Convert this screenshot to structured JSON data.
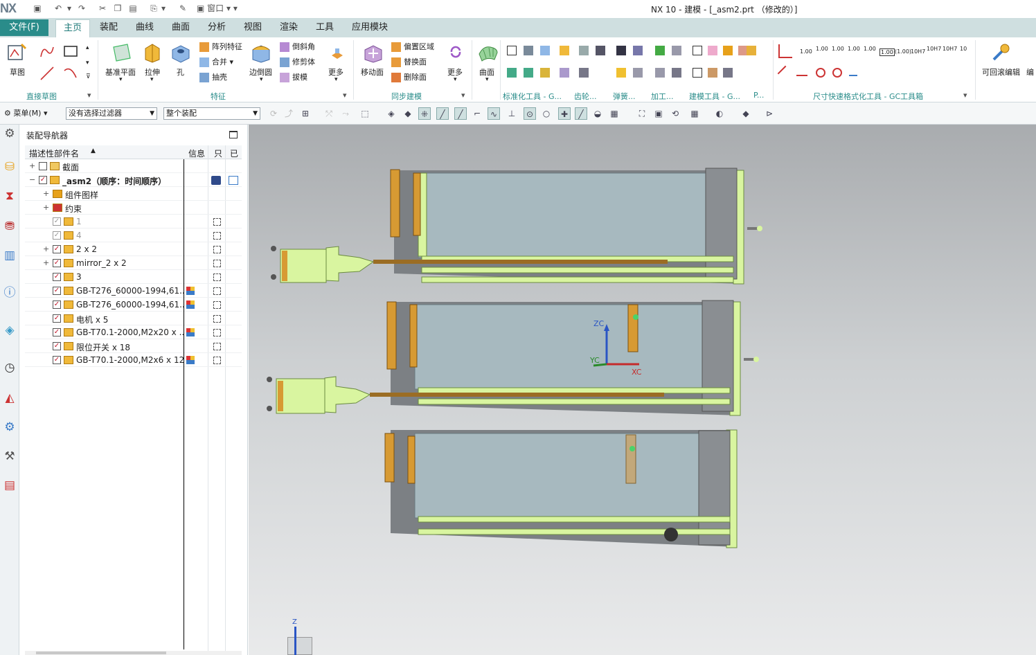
{
  "app": {
    "logo": "NX",
    "window_title": "NX 10 - 建模 - [_asm2.prt （修改的）]"
  },
  "quick_access": {
    "window_menu_label": "窗口"
  },
  "file_tab": "文件(F)",
  "tabs": [
    "主页",
    "装配",
    "曲线",
    "曲面",
    "分析",
    "视图",
    "渲染",
    "工具",
    "应用模块"
  ],
  "ribbon": {
    "sketch": "草图",
    "datum_plane": "基准平面",
    "extrude": "拉伸",
    "hole": "孔",
    "pattern_feature": "阵列特征",
    "unite": "合并",
    "shell": "抽壳",
    "edge_blend": "边倒圆",
    "chamfer": "倒斜角",
    "trim_body": "修剪体",
    "draft": "拔模",
    "more1": "更多",
    "move_face": "移动面",
    "offset_region": "偏置区域",
    "replace_face": "替换面",
    "delete_face": "删除面",
    "more2": "更多",
    "surface": "曲面",
    "rollback_edit": "可回滚编辑",
    "edit_cut": "编",
    "tol_labels": [
      "1.00",
      "1.00",
      "1.00",
      "1.00",
      "1.00",
      "1.00",
      "(1.00)",
      "10H7",
      "10H7",
      "10H7",
      "10"
    ],
    "groups": {
      "direct_sketch": "直接草图",
      "feature": "特征",
      "sync_modeling": "同步建模",
      "std_tools": "标准化工具 - G...",
      "gear": "齿轮...",
      "spring": "弹簧...",
      "machining": "加工...",
      "modeling_tools": "建模工具 - G...",
      "p": "P...",
      "dim_tools": "尺寸快速格式化工具 - GC工具箱"
    }
  },
  "toolbar2": {
    "menu": "菜单(M)",
    "filter": "没有选择过滤器",
    "scope": "整个装配"
  },
  "navigator": {
    "title": "装配导航器",
    "col_name": "描述性部件名",
    "col_info": "信息",
    "col_only": "只",
    "col_mod": "已",
    "rows": [
      {
        "label": "截面",
        "indent": 0,
        "expander": "+",
        "checked": false,
        "gray": false,
        "bold": false,
        "info": false,
        "only": false,
        "type": "folder"
      },
      {
        "label": "_asm2（顺序：时间顺序）",
        "indent": 0,
        "expander": "−",
        "checked": true,
        "gray": false,
        "bold": true,
        "info": false,
        "only": false,
        "type": "asm"
      },
      {
        "label": "组件图样",
        "indent": 1,
        "expander": "+",
        "checked": null,
        "gray": false,
        "bold": false,
        "info": false,
        "only": false,
        "type": "pattern"
      },
      {
        "label": "约束",
        "indent": 1,
        "expander": "+",
        "checked": null,
        "gray": false,
        "bold": false,
        "info": false,
        "only": false,
        "type": "constraint"
      },
      {
        "label": "1",
        "indent": 1,
        "expander": "",
        "checked": true,
        "gray": true,
        "bold": false,
        "info": false,
        "only": true,
        "type": "part"
      },
      {
        "label": "4",
        "indent": 1,
        "expander": "",
        "checked": true,
        "gray": true,
        "bold": false,
        "info": false,
        "only": true,
        "type": "part"
      },
      {
        "label": "2 x 2",
        "indent": 1,
        "expander": "+",
        "checked": true,
        "gray": false,
        "bold": false,
        "info": false,
        "only": true,
        "type": "asm"
      },
      {
        "label": "mirror_2 x 2",
        "indent": 1,
        "expander": "+",
        "checked": true,
        "gray": false,
        "bold": false,
        "info": false,
        "only": true,
        "type": "asm"
      },
      {
        "label": "3",
        "indent": 1,
        "expander": "",
        "checked": true,
        "gray": false,
        "bold": false,
        "info": false,
        "only": true,
        "type": "part"
      },
      {
        "label": "GB-T276_60000-1994,61...",
        "indent": 1,
        "expander": "",
        "checked": true,
        "gray": false,
        "bold": false,
        "info": true,
        "only": true,
        "type": "part"
      },
      {
        "label": "GB-T276_60000-1994,61...",
        "indent": 1,
        "expander": "",
        "checked": true,
        "gray": false,
        "bold": false,
        "info": true,
        "only": true,
        "type": "part"
      },
      {
        "label": "电机 x 5",
        "indent": 1,
        "expander": "",
        "checked": true,
        "gray": false,
        "bold": false,
        "info": false,
        "only": true,
        "type": "part"
      },
      {
        "label": "GB-T70.1-2000,M2x20 x ...",
        "indent": 1,
        "expander": "",
        "checked": true,
        "gray": false,
        "bold": false,
        "info": true,
        "only": true,
        "type": "part"
      },
      {
        "label": "限位开关 x 18",
        "indent": 1,
        "expander": "",
        "checked": true,
        "gray": false,
        "bold": false,
        "info": false,
        "only": true,
        "type": "part"
      },
      {
        "label": "GB-T70.1-2000,M2x6 x 12",
        "indent": 1,
        "expander": "",
        "checked": true,
        "gray": false,
        "bold": false,
        "info": true,
        "only": true,
        "type": "part"
      }
    ]
  },
  "viewport": {
    "axis_zc": "ZC",
    "axis_yc": "YC",
    "axis_xc": "XC",
    "triad_z": "Z"
  },
  "colors": {
    "accent": "#2a8c8a",
    "tab_bar": "#cfdfe0",
    "model_green": "#d9f5a0",
    "model_glass": "#a7b9bf",
    "model_frame": "#7c8084"
  }
}
